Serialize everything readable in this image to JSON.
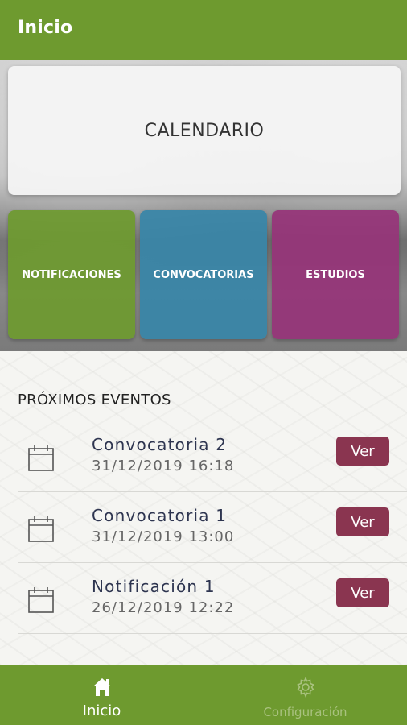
{
  "appbar": {
    "title": "Inicio"
  },
  "hero": {
    "calendar_label": "CALENDARIO",
    "tiles": [
      {
        "label": "NOTIFICACIONES",
        "color": "#6e9a2f"
      },
      {
        "label": "CONVOCATORIAS",
        "color": "#3885a8"
      },
      {
        "label": "ESTUDIOS",
        "color": "#963478"
      }
    ]
  },
  "events": {
    "heading": "PRÓXIMOS EVENTOS",
    "items": [
      {
        "name": "Convocatoria 2",
        "date": "31/12/2019 16:18",
        "button": "Ver"
      },
      {
        "name": "Convocatoria 1",
        "date": "31/12/2019 13:00",
        "button": "Ver"
      },
      {
        "name": "Notificación 1",
        "date": "26/12/2019 12:22",
        "button": "Ver"
      }
    ]
  },
  "bottom_nav": {
    "items": [
      {
        "label": "Inicio",
        "icon": "home-icon",
        "active": true
      },
      {
        "label": "Configuración",
        "icon": "gear-icon",
        "active": false
      }
    ]
  },
  "colors": {
    "brand_green": "#6e9a2f",
    "button_wine": "#8a3550",
    "event_title": "#2e3550"
  }
}
